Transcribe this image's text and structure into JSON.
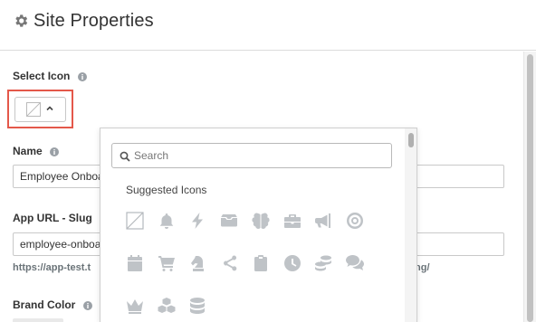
{
  "header": {
    "title": "Site Properties",
    "icon": "gear-icon"
  },
  "fields": {
    "select_icon": {
      "label": "Select Icon",
      "selected_icon": "no-icon"
    },
    "name": {
      "label": "Name",
      "value": "Employee Onboa"
    },
    "slug": {
      "label": "App URL - Slug",
      "value": "employee-onboa",
      "hint_left": "https://app-test.t",
      "hint_right": "ng/"
    },
    "brand_color": {
      "label": "Brand Color"
    }
  },
  "dropdown": {
    "search_placeholder": "Search",
    "section_title": "Suggested Icons",
    "icons": [
      "no-icon",
      "bell-icon",
      "bolt-icon",
      "inbox-icon",
      "brain-icon",
      "briefcase-icon",
      "megaphone-icon",
      "target-icon",
      "calendar-check-icon",
      "cart-icon",
      "chess-knight-icon",
      "share-nodes-icon",
      "clipboard-icon",
      "clock-icon",
      "coins-icon",
      "comments-icon",
      "crown-icon",
      "cubes-icon",
      "database-icon"
    ]
  },
  "colors": {
    "highlight": "#e4584a",
    "icon_gray": "#bfc3c7",
    "text": "#333333"
  }
}
